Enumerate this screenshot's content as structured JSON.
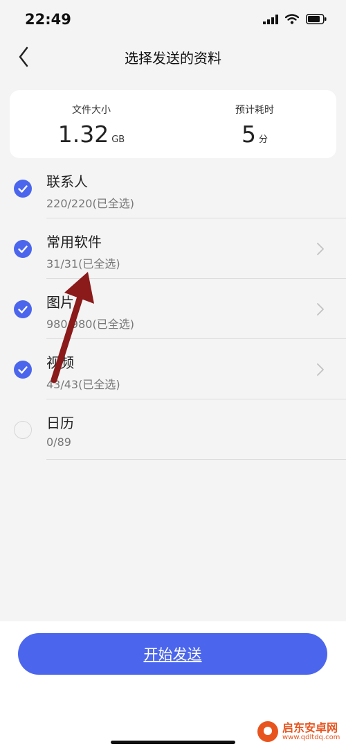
{
  "status_bar": {
    "time": "22:49"
  },
  "nav": {
    "title": "选择发送的资料"
  },
  "summary": {
    "size_label": "文件大小",
    "size_value": "1.32",
    "size_unit": "GB",
    "time_label": "预计耗时",
    "time_value": "5",
    "time_unit": "分"
  },
  "items": [
    {
      "title": "联系人",
      "subtitle": "220/220(已全选)",
      "checked": true,
      "has_chevron": false
    },
    {
      "title": "常用软件",
      "subtitle": "31/31(已全选)",
      "checked": true,
      "has_chevron": true
    },
    {
      "title": "图片",
      "subtitle": "980/980(已全选)",
      "checked": true,
      "has_chevron": true
    },
    {
      "title": "视频",
      "subtitle": "43/43(已全选)",
      "checked": true,
      "has_chevron": true
    },
    {
      "title": "日历",
      "subtitle": "0/89",
      "checked": false,
      "has_chevron": false
    }
  ],
  "footer": {
    "start_label": "开始发送"
  },
  "watermark": {
    "name": "启东安卓网",
    "url": "www.qdltdq.com"
  },
  "colors": {
    "accent": "#4b66ec",
    "background": "#f4f4f4",
    "arrow": "#8b1a1a",
    "watermark": "#e8541e"
  }
}
